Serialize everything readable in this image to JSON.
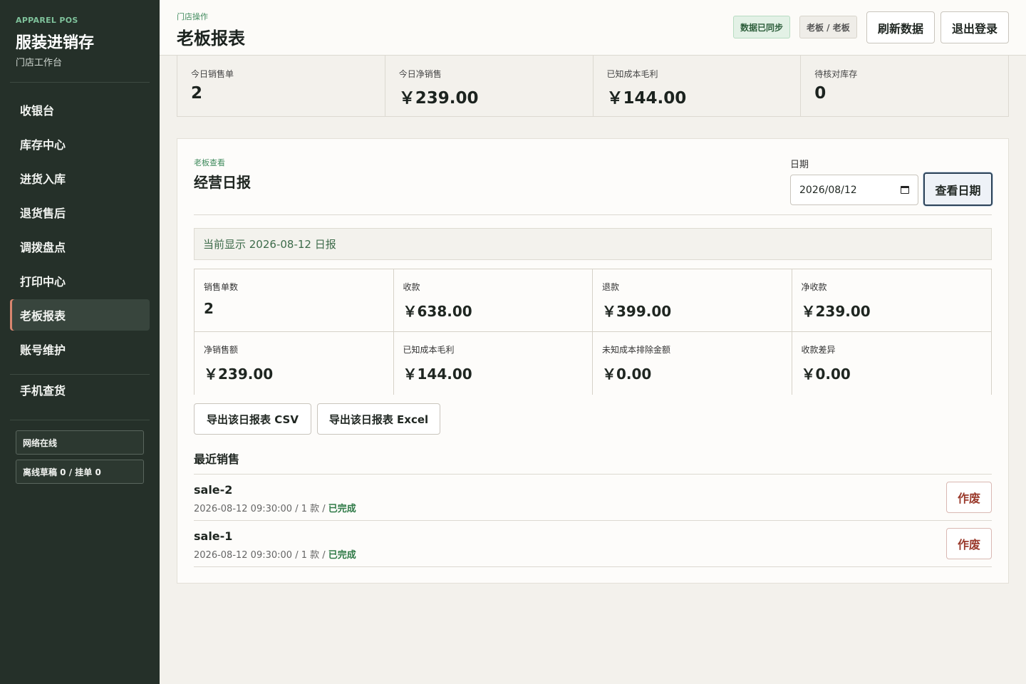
{
  "sidebar": {
    "brand_sub": "APPAREL POS",
    "brand_title": "服装进销存",
    "brand_desc": "门店工作台",
    "nav": [
      {
        "label": "收银台"
      },
      {
        "label": "库存中心"
      },
      {
        "label": "进货入库"
      },
      {
        "label": "退货售后"
      },
      {
        "label": "调拨盘点"
      },
      {
        "label": "打印中心"
      },
      {
        "label": "老板报表",
        "active": true
      },
      {
        "label": "账号维护"
      }
    ],
    "mobile_item": "手机查货",
    "network_status": "网络在线",
    "offline_status": "离线草稿 0 / 挂单 0"
  },
  "header": {
    "crumb": "门店操作",
    "title": "老板报表",
    "sync_badge": "数据已同步",
    "role_badge": "老板 / 老板",
    "refresh_label": "刷新数据",
    "logout_label": "退出登录"
  },
  "stats": [
    {
      "label": "今日销售单",
      "value": "2"
    },
    {
      "label": "今日净销售",
      "value": "￥239.00"
    },
    {
      "label": "已知成本毛利",
      "value": "￥144.00"
    },
    {
      "label": "待核对库存",
      "value": "0"
    }
  ],
  "report": {
    "crumb": "老板查看",
    "title": "经营日报",
    "date_label": "日期",
    "date_value": "2026/08/12",
    "view_button": "查看日期",
    "notice": "当前显示 2026-08-12 日报",
    "metrics": [
      {
        "label": "销售单数",
        "value": "2"
      },
      {
        "label": "收款",
        "value": "￥638.00"
      },
      {
        "label": "退款",
        "value": "￥399.00"
      },
      {
        "label": "净收款",
        "value": "￥239.00"
      },
      {
        "label": "净销售额",
        "value": "￥239.00"
      },
      {
        "label": "已知成本毛利",
        "value": "￥144.00"
      },
      {
        "label": "未知成本排除金额",
        "value": "￥0.00"
      },
      {
        "label": "收款差异",
        "value": "￥0.00"
      }
    ],
    "export_csv": "导出该日报表 CSV",
    "export_excel": "导出该日报表 Excel",
    "recent_title": "最近销售",
    "sales": [
      {
        "id": "sale-2",
        "meta": "2026-08-12 09:30:00 / 1 款 / ",
        "status": "已完成",
        "action": "作废"
      },
      {
        "id": "sale-1",
        "meta": "2026-08-12 09:30:00 / 1 款 / ",
        "status": "已完成",
        "action": "作废"
      }
    ]
  }
}
